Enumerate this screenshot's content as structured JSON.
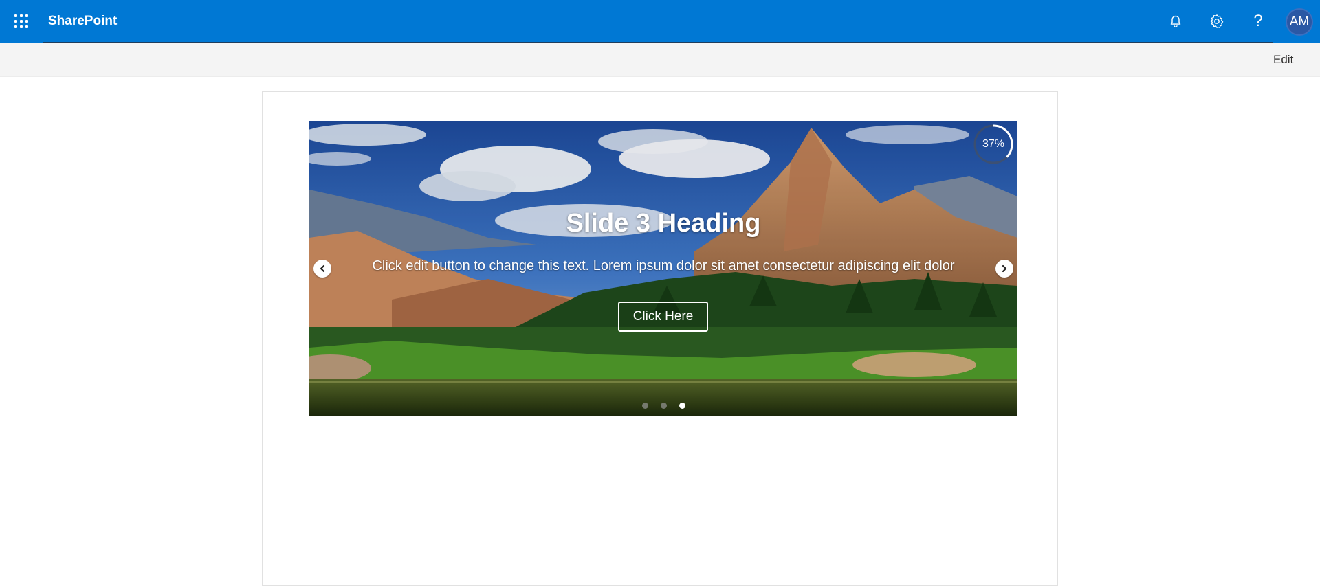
{
  "suite_bar": {
    "app_name": "SharePoint",
    "waffle_icon": "waffle-icon",
    "icons": [
      "bell-icon",
      "gear-icon",
      "help-icon"
    ],
    "help_glyph": "?",
    "avatar_initials": "AM",
    "color": "#0078d4"
  },
  "command_bar": {
    "edit_label": "Edit"
  },
  "carousel": {
    "heading": "Slide 3 Heading",
    "text": "Click edit button to change this text. Lorem ipsum dolor sit amet consectetur adipiscing elit dolor",
    "button_label": "Click Here",
    "progress_label": "37%",
    "progress_value": 0.37,
    "slide_count": 3,
    "active_slide": 3,
    "prev_icon": "chevron-left-icon",
    "next_icon": "chevron-right-icon"
  }
}
